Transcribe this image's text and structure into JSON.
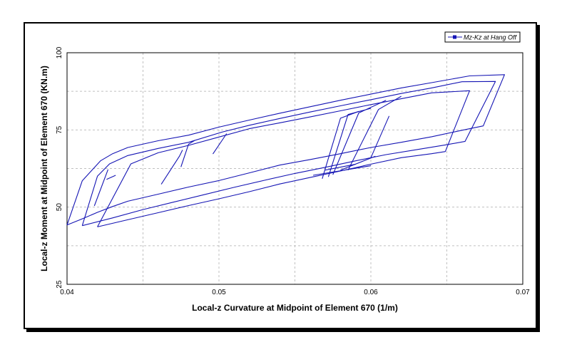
{
  "colors": {
    "series": "#1414b4",
    "grid": "#c0c0c0",
    "frame": "#000000"
  },
  "chart_data": {
    "type": "line",
    "title": "",
    "xlabel": "Local-z Curvature at Midpoint of Element 670 (1/m)",
    "ylabel": "Local-z Moment at Midpoint of Element 670 (KN.m)",
    "xlim": [
      0.04,
      0.07
    ],
    "ylim": [
      25,
      100
    ],
    "xticks": [
      0.04,
      0.05,
      0.06,
      0.07
    ],
    "xtick_labels": [
      "0.04",
      "0.05",
      "0.06",
      "0.07"
    ],
    "yticks": [
      25,
      50,
      75,
      100
    ],
    "ytick_labels": [
      "25",
      "50",
      "75",
      "100"
    ],
    "grid": true,
    "legend_position": "top-right",
    "series": [
      {
        "name": "Mz-Kz at Hang Off",
        "segments": [
          [
            [
              0.04,
              44.2
            ],
            [
              0.041,
              46.2
            ],
            [
              0.042,
              48.3
            ],
            [
              0.043,
              50.2
            ],
            [
              0.044,
              51.9
            ],
            [
              0.046,
              54.2
            ],
            [
              0.048,
              56.5
            ],
            [
              0.05,
              58.6
            ],
            [
              0.052,
              61.1
            ],
            [
              0.054,
              63.6
            ],
            [
              0.056,
              65.4
            ],
            [
              0.058,
              67.3
            ],
            [
              0.06,
              69.3
            ],
            [
              0.062,
              71.0
            ],
            [
              0.064,
              72.8
            ],
            [
              0.066,
              74.9
            ],
            [
              0.0674,
              76.3
            ],
            [
              0.0688,
              92.9
            ],
            [
              0.0665,
              92.5
            ],
            [
              0.064,
              90.3
            ],
            [
              0.062,
              88.6
            ],
            [
              0.06,
              86.6
            ],
            [
              0.058,
              84.6
            ],
            [
              0.056,
              82.5
            ],
            [
              0.054,
              80.4
            ],
            [
              0.052,
              78.2
            ],
            [
              0.05,
              75.9
            ],
            [
              0.048,
              73.3
            ],
            [
              0.046,
              71.5
            ],
            [
              0.044,
              69.3
            ],
            [
              0.043,
              67.3
            ],
            [
              0.0422,
              65.0
            ],
            [
              0.041,
              58.5
            ],
            [
              0.04,
              44.2
            ]
          ],
          [
            [
              0.041,
              44.0
            ],
            [
              0.043,
              46.5
            ],
            [
              0.045,
              49.2
            ],
            [
              0.047,
              51.6
            ],
            [
              0.049,
              54.0
            ],
            [
              0.051,
              56.4
            ],
            [
              0.053,
              58.7
            ],
            [
              0.055,
              60.9
            ],
            [
              0.057,
              62.9
            ],
            [
              0.059,
              65.0
            ],
            [
              0.061,
              67.0
            ],
            [
              0.063,
              68.6
            ],
            [
              0.065,
              70.2
            ],
            [
              0.0662,
              71.3
            ],
            [
              0.0682,
              90.7
            ],
            [
              0.066,
              90.6
            ],
            [
              0.064,
              88.6
            ],
            [
              0.062,
              86.8
            ],
            [
              0.06,
              84.8
            ],
            [
              0.058,
              82.8
            ],
            [
              0.056,
              80.8
            ],
            [
              0.054,
              78.7
            ],
            [
              0.052,
              76.5
            ],
            [
              0.0502,
              74.3
            ],
            [
              0.048,
              71.0
            ],
            [
              0.046,
              69.0
            ],
            [
              0.044,
              66.7
            ],
            [
              0.0428,
              64.0
            ],
            [
              0.042,
              60.0
            ],
            [
              0.041,
              44.0
            ]
          ],
          [
            [
              0.042,
              43.6
            ],
            [
              0.044,
              45.9
            ],
            [
              0.046,
              48.2
            ],
            [
              0.048,
              50.5
            ],
            [
              0.05,
              52.7
            ],
            [
              0.052,
              55.0
            ],
            [
              0.054,
              57.5
            ],
            [
              0.056,
              59.6
            ],
            [
              0.058,
              61.7
            ],
            [
              0.06,
              63.9
            ],
            [
              0.062,
              66.0
            ],
            [
              0.064,
              67.3
            ],
            [
              0.0649,
              68.0
            ],
            [
              0.0665,
              87.7
            ],
            [
              0.064,
              87.0
            ],
            [
              0.062,
              85.1
            ],
            [
              0.06,
              83.2
            ],
            [
              0.058,
              81.2
            ],
            [
              0.056,
              79.2
            ],
            [
              0.054,
              77.3
            ],
            [
              0.052,
              75.4
            ],
            [
              0.05,
              72.7
            ],
            [
              0.048,
              70.0
            ],
            [
              0.046,
              67.6
            ],
            [
              0.0442,
              64.0
            ],
            [
              0.042,
              43.6
            ]
          ],
          [
            [
              0.0418,
              50.4
            ],
            [
              0.0427,
              62.2
            ]
          ],
          [
            [
              0.0426,
              59.0
            ],
            [
              0.0432,
              60.3
            ]
          ],
          [
            [
              0.0462,
              57.4
            ],
            [
              0.0474,
              66.5
            ],
            [
              0.0476,
              68.5
            ]
          ],
          [
            [
              0.0475,
              63.0
            ],
            [
              0.048,
              70.4
            ],
            [
              0.0484,
              71.6
            ]
          ],
          [
            [
              0.0496,
              67.2
            ],
            [
              0.0503,
              72.3
            ],
            [
              0.0505,
              73.8
            ]
          ],
          [
            [
              0.0562,
              60.3
            ],
            [
              0.06,
              63.4
            ]
          ],
          [
            [
              0.0568,
              59.2
            ],
            [
              0.058,
              78.8
            ],
            [
              0.0592,
              81.0
            ]
          ],
          [
            [
              0.0572,
              59.8
            ],
            [
              0.0585,
              80.0
            ],
            [
              0.06,
              82.0
            ]
          ],
          [
            [
              0.0575,
              60.5
            ],
            [
              0.0592,
              80.5
            ],
            [
              0.061,
              84.6
            ]
          ],
          [
            [
              0.0585,
              62.0
            ],
            [
              0.0605,
              81.6
            ],
            [
              0.062,
              85.9
            ]
          ],
          [
            [
              0.06,
              66.0
            ],
            [
              0.0612,
              79.5
            ]
          ],
          [
            [
              0.058,
              62.0
            ],
            [
              0.0603,
              66.5
            ]
          ],
          [
            [
              0.057,
              62.0
            ],
            [
              0.059,
              63.9
            ]
          ]
        ]
      }
    ]
  }
}
